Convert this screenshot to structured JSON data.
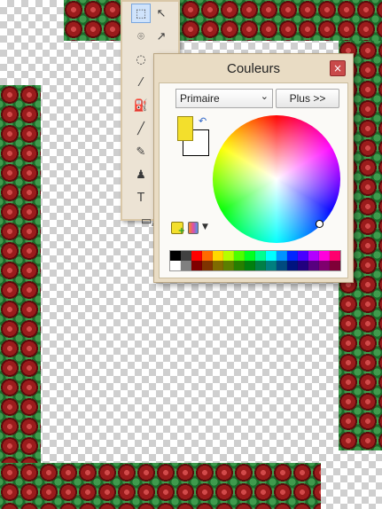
{
  "colors_window": {
    "title": "Couleurs",
    "close_glyph": "×",
    "mode": "Primaire",
    "more_label": "Plus >>",
    "primary_color": "#f3df2c",
    "secondary_color": "#ffffff"
  },
  "palette": [
    "#000000",
    "#404040",
    "#ff0000",
    "#ff6a00",
    "#ffd800",
    "#b6ff00",
    "#4cff00",
    "#00ff21",
    "#00ff90",
    "#00ffff",
    "#0094ff",
    "#0026ff",
    "#4800ff",
    "#b200ff",
    "#ff00dc",
    "#ff006e",
    "#ffffff",
    "#808080",
    "#7f0000",
    "#7f3300",
    "#7f6a00",
    "#5b7f00",
    "#267f00",
    "#007f0e",
    "#007f46",
    "#007f7f",
    "#004a7f",
    "#00137f",
    "#21007f",
    "#57007f",
    "#7f006e",
    "#7f0037"
  ],
  "tools": [
    {
      "name": "rectangle-select-icon",
      "glyph": "⬚",
      "selected": true
    },
    {
      "name": "move-selection-icon",
      "glyph": "↖"
    },
    {
      "name": "lasso-select-icon",
      "glyph": "⌾"
    },
    {
      "name": "move-selected-icon",
      "glyph": "↗"
    },
    {
      "name": "ellipse-select-icon",
      "glyph": "◌"
    },
    {
      "name": "zoom-icon",
      "glyph": "⌕"
    },
    {
      "name": "magic-wand-icon",
      "glyph": "⁄"
    },
    {
      "name": "pan-icon",
      "glyph": "✋"
    },
    {
      "name": "paint-bucket-icon",
      "glyph": "⛽"
    },
    {
      "name": "gradient-icon",
      "glyph": "▥"
    },
    {
      "name": "paintbrush-icon",
      "glyph": "╱"
    },
    {
      "name": "eraser-icon",
      "glyph": "▱"
    },
    {
      "name": "pencil-icon",
      "glyph": "✎"
    },
    {
      "name": "color-picker-icon",
      "glyph": "⟋"
    },
    {
      "name": "clone-stamp-icon",
      "glyph": "♟"
    },
    {
      "name": "recolor-icon",
      "glyph": "⁂"
    },
    {
      "name": "text-icon",
      "glyph": "T"
    },
    {
      "name": "line-curve-icon",
      "glyph": "\\/"
    },
    {
      "name": "shapes-icon",
      "glyph": "▭△"
    }
  ]
}
